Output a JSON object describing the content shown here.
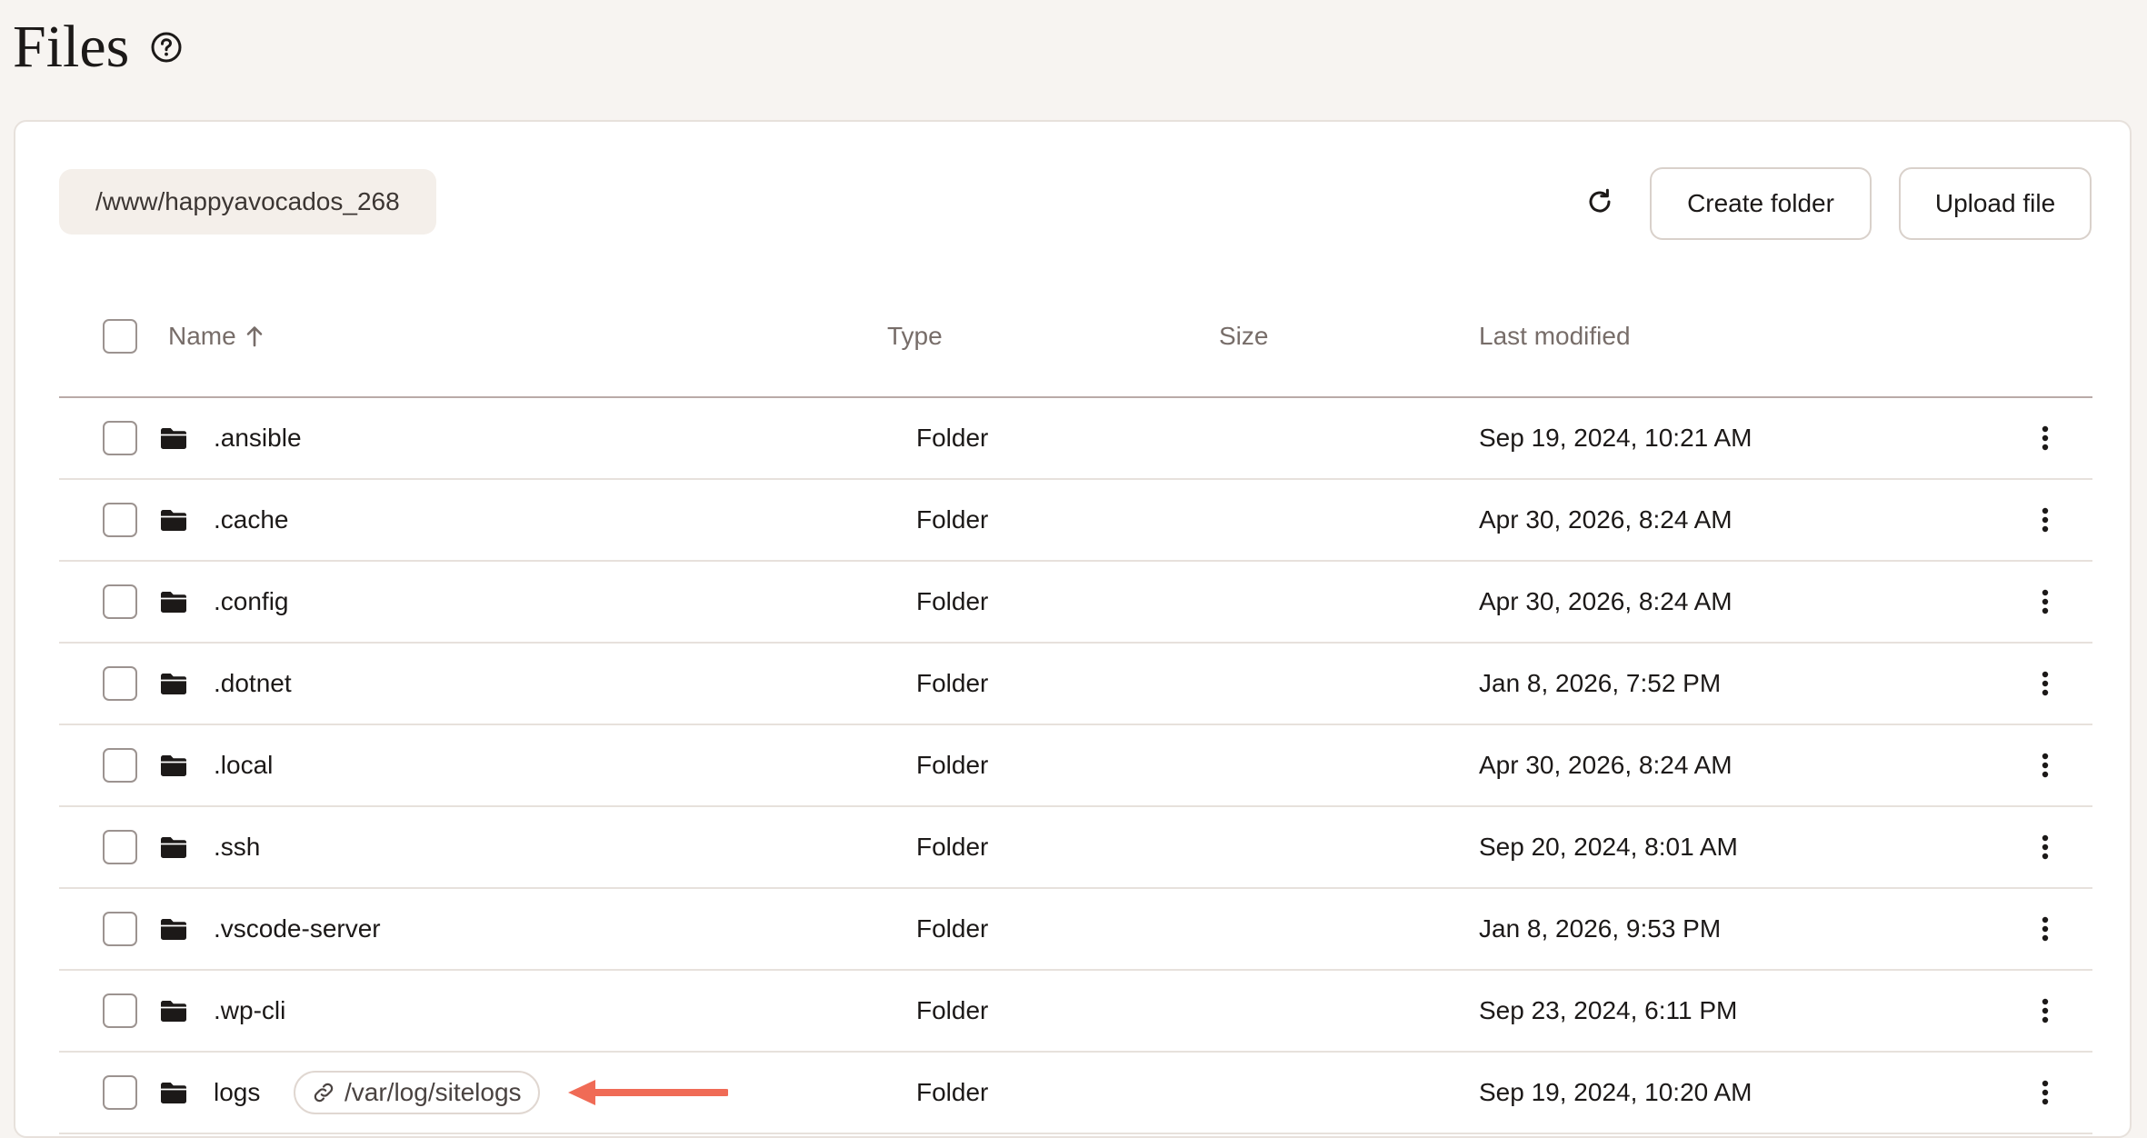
{
  "page": {
    "title": "Files"
  },
  "toolbar": {
    "path": "/www/happyavocados_268",
    "create_folder_label": "Create folder",
    "upload_file_label": "Upload file"
  },
  "table": {
    "columns": {
      "name": "Name",
      "type": "Type",
      "size": "Size",
      "last_modified": "Last modified"
    },
    "sort_direction": "ascending",
    "rows": [
      {
        "name": ".ansible",
        "type": "Folder",
        "size": "",
        "modified": "Sep 19, 2024, 10:21 AM"
      },
      {
        "name": ".cache",
        "type": "Folder",
        "size": "",
        "modified": "Apr 30, 2026, 8:24 AM"
      },
      {
        "name": ".config",
        "type": "Folder",
        "size": "",
        "modified": "Apr 30, 2026, 8:24 AM"
      },
      {
        "name": ".dotnet",
        "type": "Folder",
        "size": "",
        "modified": "Jan 8, 2026, 7:52 PM"
      },
      {
        "name": ".local",
        "type": "Folder",
        "size": "",
        "modified": "Apr 30, 2026, 8:24 AM"
      },
      {
        "name": ".ssh",
        "type": "Folder",
        "size": "",
        "modified": "Sep 20, 2024, 8:01 AM"
      },
      {
        "name": ".vscode-server",
        "type": "Folder",
        "size": "",
        "modified": "Jan 8, 2026, 9:53 PM"
      },
      {
        "name": ".wp-cli",
        "type": "Folder",
        "size": "",
        "modified": "Sep 23, 2024, 6:11 PM"
      },
      {
        "name": "logs",
        "type": "Folder",
        "size": "",
        "modified": "Sep 19, 2024, 10:20 AM",
        "symlink_target": "/var/log/sitelogs"
      }
    ]
  },
  "colors": {
    "background": "#f7f4f1",
    "card": "#ffffff",
    "accent_arrow": "#f06b56",
    "text": "#1c1918",
    "muted_text": "#776d69"
  },
  "icons": [
    "help-icon",
    "refresh-icon",
    "sort-ascending-icon",
    "folder-icon",
    "link-icon",
    "more-vertical-icon",
    "annotation-arrow"
  ]
}
